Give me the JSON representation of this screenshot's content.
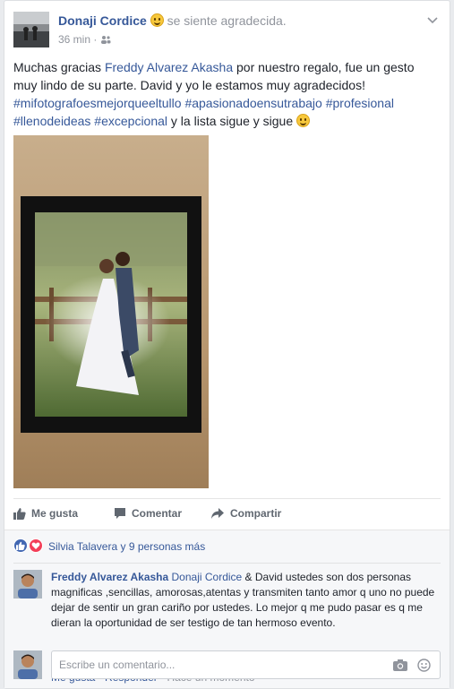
{
  "post": {
    "author": "Donaji Cordice",
    "feeling": "se siente agradecida.",
    "time": "36 min",
    "audience_icon": "friends-icon",
    "text_start": "Muchas gracias ",
    "tagged": "Freddy Alvarez Akasha",
    "text_mid": " por nuestro regalo, fue un gesto muy lindo de su parte. David y yo le estamos muy agradecidos! ",
    "hashtags": [
      "#mifotografoesmejorqueeltullo",
      "#apasionadoensutrabajo",
      "#profesional",
      "#llenodeideas",
      "#excepcional"
    ],
    "text_end": " y la lista sigue y sigue "
  },
  "actions": {
    "like": "Me gusta",
    "comment": "Comentar",
    "share": "Compartir"
  },
  "reactions": {
    "text": "Silvia Talavera y 9 personas más",
    "colors": {
      "like": "#4267b2",
      "love": "#f33e58"
    }
  },
  "comment": {
    "author": "Freddy Alvarez Akasha",
    "mention": "Donaji Cordice",
    "text": " & David ustedes son dos personas magnificas ,sencillas, amorosas,atentas y transmiten tanto amor q uno no puede dejar de sentir un gran cariño por ustedes. Lo mejor q me pudo pasar es q me dieran la oportunidad de ser testigo de tan hermoso evento.",
    "like": "Me gusta",
    "reply": "Responder",
    "sep": "·",
    "time": "Hace un momento"
  },
  "composer": {
    "placeholder": "Escribe un comentario..."
  },
  "colors": {
    "link": "#365899",
    "muted": "#90949c",
    "background": "#e9ebee"
  }
}
